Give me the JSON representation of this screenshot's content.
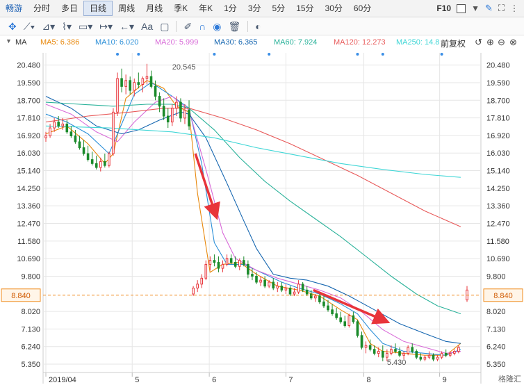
{
  "tabs": {
    "items": [
      "畅游",
      "分时",
      "多日",
      "日线",
      "周线",
      "月线",
      "季K",
      "年K",
      "1分",
      "3分",
      "5分",
      "15分",
      "30分",
      "60分"
    ],
    "active_index": 3,
    "f10": "F10",
    "small_down": "▼",
    "more": "⋮"
  },
  "toolbar": {
    "text_tool": "Aa"
  },
  "ma_bar": {
    "label": "MA",
    "items": [
      {
        "label": "MA5: 6.386",
        "color": "#e8880c"
      },
      {
        "label": "MA10: 6.020",
        "color": "#2b8fd8"
      },
      {
        "label": "MA20: 5.999",
        "color": "#d86ad8"
      },
      {
        "label": "MA30: 6.365",
        "color": "#1566b0"
      },
      {
        "label": "MA60: 7.924",
        "color": "#2ab29a"
      },
      {
        "label": "MA120: 12.273",
        "color": "#e85a5a"
      },
      {
        "label": "MA250: 14.8",
        "color": "#3fd6d6"
      }
    ],
    "adjust": "前复权"
  },
  "colors": {
    "up": "#e8343a",
    "down": "#1a8a2a",
    "current": "#f08c1e",
    "arrow": "#e8343a",
    "grid": "#e6e6e6",
    "axis_text": "#333333"
  },
  "chart_data": {
    "type": "line",
    "title": "",
    "y_ticks": [
      20.48,
      19.59,
      18.7,
      17.81,
      16.92,
      16.03,
      15.14,
      14.25,
      13.36,
      12.47,
      11.58,
      10.69,
      9.8,
      8.84,
      8.02,
      7.13,
      6.24,
      5.35
    ],
    "ylim": [
      5.0,
      21.1
    ],
    "x_labels": [
      {
        "label": "2019/04",
        "t": 0.0
      },
      {
        "label": "5",
        "t": 0.205
      },
      {
        "label": "6",
        "t": 0.388
      },
      {
        "label": "7",
        "t": 0.57
      },
      {
        "label": "8",
        "t": 0.755
      },
      {
        "label": "9",
        "t": 0.935
      }
    ],
    "current_price": 8.84,
    "current_label": "8.840",
    "annotations": [
      {
        "text": "20.545",
        "t": 0.3,
        "y": 20.4
      },
      {
        "text": "5.430",
        "t": 0.81,
        "y": 5.45
      }
    ],
    "candles_t": [
      0.0,
      0.01,
      0.02,
      0.03,
      0.04,
      0.05,
      0.06,
      0.07,
      0.08,
      0.09,
      0.1,
      0.11,
      0.12,
      0.13,
      0.14,
      0.15,
      0.16,
      0.17,
      0.18,
      0.19,
      0.2,
      0.21,
      0.22,
      0.23,
      0.24,
      0.25,
      0.26,
      0.27,
      0.28,
      0.29,
      0.3,
      0.31,
      0.32,
      0.33,
      0.34,
      0.35,
      0.36,
      0.37,
      0.38,
      0.39,
      0.4,
      0.41,
      0.42,
      0.43,
      0.44,
      0.45,
      0.46,
      0.47,
      0.48,
      0.49,
      0.5,
      0.51,
      0.52,
      0.53,
      0.54,
      0.55,
      0.56,
      0.57,
      0.58,
      0.59,
      0.6,
      0.61,
      0.62,
      0.63,
      0.64,
      0.65,
      0.66,
      0.67,
      0.68,
      0.69,
      0.7,
      0.71,
      0.72,
      0.73,
      0.74,
      0.75,
      0.76,
      0.77,
      0.78,
      0.79,
      0.8,
      0.81,
      0.82,
      0.83,
      0.84,
      0.85,
      0.86,
      0.87,
      0.88,
      0.89,
      0.9,
      0.91,
      0.92,
      0.93,
      0.94,
      0.95,
      0.96,
      0.97,
      0.98,
      1.0
    ],
    "candles_ohlc": [
      [
        16.8,
        17.1,
        16.6,
        16.9
      ],
      [
        16.9,
        17.5,
        16.8,
        17.3
      ],
      [
        17.3,
        17.8,
        17.1,
        17.6
      ],
      [
        17.6,
        17.9,
        17.3,
        17.4
      ],
      [
        17.4,
        17.8,
        17.2,
        17.5
      ],
      [
        17.5,
        17.7,
        17.0,
        17.1
      ],
      [
        17.1,
        17.4,
        16.8,
        16.9
      ],
      [
        16.9,
        17.2,
        16.5,
        16.6
      ],
      [
        16.6,
        16.9,
        16.2,
        16.3
      ],
      [
        16.3,
        16.7,
        15.9,
        16.0
      ],
      [
        16.0,
        16.4,
        15.6,
        15.7
      ],
      [
        15.7,
        16.1,
        15.4,
        15.5
      ],
      [
        15.5,
        15.9,
        15.2,
        15.3
      ],
      [
        15.3,
        15.8,
        15.1,
        15.6
      ],
      [
        15.6,
        16.0,
        15.3,
        15.4
      ],
      [
        15.4,
        16.1,
        15.3,
        16.0
      ],
      [
        16.0,
        18.3,
        15.9,
        18.1
      ],
      [
        18.1,
        20.1,
        17.9,
        19.8
      ],
      [
        19.8,
        20.3,
        19.1,
        19.4
      ],
      [
        19.4,
        20.0,
        19.0,
        19.7
      ],
      [
        19.7,
        19.9,
        19.0,
        19.2
      ],
      [
        19.2,
        19.8,
        18.9,
        19.6
      ],
      [
        19.6,
        20.1,
        19.3,
        19.5
      ],
      [
        19.5,
        19.9,
        19.1,
        19.8
      ],
      [
        19.8,
        20.545,
        19.5,
        19.9
      ],
      [
        19.9,
        20.2,
        19.3,
        19.4
      ],
      [
        19.4,
        19.7,
        18.7,
        18.9
      ],
      [
        18.9,
        19.1,
        18.1,
        18.4
      ],
      [
        18.4,
        18.8,
        17.7,
        17.9
      ],
      [
        17.9,
        18.3,
        17.3,
        17.6
      ],
      [
        17.6,
        18.5,
        17.4,
        18.3
      ],
      [
        18.3,
        18.9,
        17.9,
        18.6
      ],
      [
        18.6,
        18.8,
        17.6,
        17.8
      ],
      [
        17.8,
        18.5,
        17.5,
        18.2
      ],
      [
        18.2,
        18.7,
        17.2,
        17.4
      ],
      [
        8.9,
        9.3,
        8.8,
        9.2
      ],
      [
        9.2,
        9.6,
        9.0,
        9.4
      ],
      [
        9.4,
        9.9,
        9.2,
        9.7
      ],
      [
        9.7,
        10.6,
        9.6,
        10.4
      ],
      [
        10.4,
        10.8,
        10.1,
        10.6
      ],
      [
        10.6,
        10.9,
        10.3,
        10.5
      ],
      [
        10.5,
        10.8,
        10.0,
        10.2
      ],
      [
        10.2,
        10.6,
        10.0,
        10.4
      ],
      [
        10.4,
        10.9,
        10.3,
        10.7
      ],
      [
        10.7,
        10.9,
        10.4,
        10.5
      ],
      [
        10.5,
        10.8,
        10.2,
        10.3
      ],
      [
        10.3,
        10.7,
        10.1,
        10.6
      ],
      [
        10.6,
        10.8,
        10.3,
        10.4
      ],
      [
        10.4,
        10.6,
        9.7,
        9.9
      ],
      [
        9.9,
        10.2,
        9.6,
        9.8
      ],
      [
        9.8,
        10.0,
        9.4,
        9.5
      ],
      [
        9.5,
        9.8,
        9.3,
        9.6
      ],
      [
        9.6,
        9.8,
        9.2,
        9.3
      ],
      [
        9.3,
        9.6,
        9.2,
        9.5
      ],
      [
        9.5,
        9.7,
        9.1,
        9.2
      ],
      [
        9.2,
        9.5,
        9.0,
        9.3
      ],
      [
        9.3,
        9.5,
        9.0,
        9.1
      ],
      [
        9.1,
        9.4,
        8.9,
        9.2
      ],
      [
        9.2,
        9.3,
        8.8,
        8.9
      ],
      [
        8.9,
        9.2,
        8.8,
        9.0
      ],
      [
        9.0,
        9.6,
        8.9,
        9.4
      ],
      [
        9.4,
        9.5,
        9.0,
        9.1
      ],
      [
        9.1,
        9.3,
        8.8,
        8.9
      ],
      [
        8.9,
        9.1,
        8.6,
        8.7
      ],
      [
        8.7,
        8.9,
        8.5,
        8.8
      ],
      [
        8.8,
        9.0,
        8.4,
        8.5
      ],
      [
        8.5,
        8.8,
        8.2,
        8.3
      ],
      [
        8.3,
        8.6,
        8.0,
        8.1
      ],
      [
        8.1,
        8.4,
        7.8,
        7.9
      ],
      [
        7.9,
        8.2,
        7.6,
        7.7
      ],
      [
        7.7,
        8.0,
        7.4,
        7.5
      ],
      [
        7.5,
        7.8,
        7.2,
        7.3
      ],
      [
        7.3,
        7.9,
        7.2,
        7.8
      ],
      [
        7.8,
        8.0,
        7.4,
        7.5
      ],
      [
        7.5,
        7.6,
        6.7,
        6.8
      ],
      [
        6.8,
        7.0,
        6.1,
        6.2
      ],
      [
        6.2,
        6.5,
        5.9,
        6.3
      ],
      [
        6.3,
        6.6,
        6.0,
        6.1
      ],
      [
        6.1,
        6.3,
        5.8,
        5.9
      ],
      [
        5.9,
        6.2,
        5.7,
        6.0
      ],
      [
        6.0,
        6.3,
        5.5,
        5.7
      ],
      [
        5.7,
        6.1,
        5.5,
        5.9
      ],
      [
        5.9,
        6.3,
        5.8,
        6.1
      ],
      [
        6.1,
        6.4,
        5.9,
        6.0
      ],
      [
        6.0,
        6.2,
        5.7,
        5.8
      ],
      [
        5.8,
        6.0,
        5.6,
        5.9
      ],
      [
        5.9,
        6.3,
        5.8,
        6.2
      ],
      [
        6.2,
        6.4,
        5.9,
        6.0
      ],
      [
        6.0,
        6.1,
        5.6,
        5.7
      ],
      [
        5.7,
        5.9,
        5.5,
        5.6
      ],
      [
        5.6,
        5.8,
        5.5,
        5.7
      ],
      [
        5.7,
        6.0,
        5.6,
        5.8
      ],
      [
        5.8,
        5.9,
        5.5,
        5.6
      ],
      [
        5.6,
        5.8,
        5.5,
        5.7
      ],
      [
        5.7,
        6.0,
        5.6,
        5.9
      ],
      [
        5.9,
        6.1,
        5.7,
        5.8
      ],
      [
        5.8,
        6.0,
        5.7,
        5.9
      ],
      [
        5.9,
        6.1,
        5.8,
        6.0
      ],
      [
        6.0,
        6.3,
        5.9,
        6.2
      ],
      [
        8.6,
        9.3,
        8.5,
        9.1
      ]
    ],
    "series": [
      {
        "label": "MA5",
        "color": "#e8880c",
        "points": [
          [
            0.0,
            17.0
          ],
          [
            0.05,
            17.4
          ],
          [
            0.1,
            16.5
          ],
          [
            0.14,
            15.5
          ],
          [
            0.16,
            16.0
          ],
          [
            0.19,
            18.8
          ],
          [
            0.24,
            19.7
          ],
          [
            0.28,
            19.3
          ],
          [
            0.31,
            18.4
          ],
          [
            0.34,
            18.1
          ],
          [
            0.36,
            14.0
          ],
          [
            0.39,
            10.0
          ],
          [
            0.42,
            10.4
          ],
          [
            0.46,
            10.5
          ],
          [
            0.5,
            9.9
          ],
          [
            0.55,
            9.3
          ],
          [
            0.6,
            9.1
          ],
          [
            0.65,
            8.8
          ],
          [
            0.7,
            8.1
          ],
          [
            0.74,
            7.6
          ],
          [
            0.77,
            6.4
          ],
          [
            0.8,
            6.0
          ],
          [
            0.85,
            5.9
          ],
          [
            0.9,
            5.8
          ],
          [
            0.95,
            5.8
          ],
          [
            0.985,
            6.4
          ]
        ]
      },
      {
        "label": "MA10",
        "color": "#2b8fd8",
        "points": [
          [
            0.0,
            18.0
          ],
          [
            0.05,
            17.6
          ],
          [
            0.1,
            17.0
          ],
          [
            0.15,
            16.0
          ],
          [
            0.18,
            17.5
          ],
          [
            0.21,
            19.0
          ],
          [
            0.25,
            19.6
          ],
          [
            0.3,
            18.9
          ],
          [
            0.34,
            18.3
          ],
          [
            0.37,
            15.5
          ],
          [
            0.4,
            11.5
          ],
          [
            0.43,
            10.4
          ],
          [
            0.47,
            10.4
          ],
          [
            0.51,
            10.0
          ],
          [
            0.56,
            9.5
          ],
          [
            0.6,
            9.2
          ],
          [
            0.65,
            8.9
          ],
          [
            0.7,
            8.4
          ],
          [
            0.74,
            7.9
          ],
          [
            0.77,
            7.1
          ],
          [
            0.8,
            6.4
          ],
          [
            0.85,
            6.0
          ],
          [
            0.9,
            5.9
          ],
          [
            0.95,
            5.8
          ],
          [
            0.985,
            6.1
          ]
        ]
      },
      {
        "label": "MA20",
        "color": "#d86ad8",
        "points": [
          [
            0.0,
            18.5
          ],
          [
            0.06,
            18.0
          ],
          [
            0.12,
            17.1
          ],
          [
            0.17,
            16.6
          ],
          [
            0.21,
            17.6
          ],
          [
            0.26,
            18.6
          ],
          [
            0.3,
            18.9
          ],
          [
            0.34,
            18.2
          ],
          [
            0.38,
            15.2
          ],
          [
            0.42,
            12.0
          ],
          [
            0.45,
            10.7
          ],
          [
            0.5,
            10.1
          ],
          [
            0.55,
            9.7
          ],
          [
            0.6,
            9.4
          ],
          [
            0.65,
            9.1
          ],
          [
            0.7,
            8.7
          ],
          [
            0.75,
            8.0
          ],
          [
            0.8,
            7.1
          ],
          [
            0.85,
            6.5
          ],
          [
            0.9,
            6.2
          ],
          [
            0.95,
            5.9
          ],
          [
            0.985,
            6.0
          ]
        ]
      },
      {
        "label": "MA30",
        "color": "#1566b0",
        "points": [
          [
            0.0,
            18.9
          ],
          [
            0.06,
            18.3
          ],
          [
            0.12,
            17.4
          ],
          [
            0.18,
            17.0
          ],
          [
            0.22,
            17.2
          ],
          [
            0.27,
            17.7
          ],
          [
            0.32,
            18.1
          ],
          [
            0.34,
            18.0
          ],
          [
            0.38,
            16.8
          ],
          [
            0.43,
            14.5
          ],
          [
            0.47,
            12.6
          ],
          [
            0.5,
            11.2
          ],
          [
            0.54,
            9.9
          ],
          [
            0.58,
            9.7
          ],
          [
            0.62,
            9.6
          ],
          [
            0.67,
            9.3
          ],
          [
            0.72,
            8.8
          ],
          [
            0.78,
            8.1
          ],
          [
            0.84,
            7.4
          ],
          [
            0.9,
            6.9
          ],
          [
            0.95,
            6.5
          ],
          [
            0.985,
            6.4
          ]
        ]
      },
      {
        "label": "MA60",
        "color": "#2ab29a",
        "points": [
          [
            0.0,
            18.6
          ],
          [
            0.08,
            18.5
          ],
          [
            0.16,
            18.4
          ],
          [
            0.24,
            18.5
          ],
          [
            0.3,
            18.5
          ],
          [
            0.34,
            18.3
          ],
          [
            0.4,
            17.2
          ],
          [
            0.46,
            15.8
          ],
          [
            0.52,
            14.6
          ],
          [
            0.58,
            13.6
          ],
          [
            0.64,
            12.7
          ],
          [
            0.7,
            11.8
          ],
          [
            0.76,
            10.8
          ],
          [
            0.82,
            9.8
          ],
          [
            0.88,
            8.9
          ],
          [
            0.93,
            8.3
          ],
          [
            0.985,
            7.9
          ]
        ]
      },
      {
        "label": "MA120",
        "color": "#e85a5a",
        "points": [
          [
            0.0,
            17.6
          ],
          [
            0.1,
            17.9
          ],
          [
            0.2,
            18.1
          ],
          [
            0.28,
            18.3
          ],
          [
            0.34,
            18.3
          ],
          [
            0.42,
            17.8
          ],
          [
            0.5,
            17.2
          ],
          [
            0.58,
            16.5
          ],
          [
            0.66,
            15.7
          ],
          [
            0.74,
            14.9
          ],
          [
            0.82,
            14.0
          ],
          [
            0.9,
            13.1
          ],
          [
            0.985,
            12.3
          ]
        ]
      },
      {
        "label": "MA250",
        "color": "#3fd6d6",
        "points": [
          [
            0.0,
            17.4
          ],
          [
            0.15,
            17.3
          ],
          [
            0.3,
            17.1
          ],
          [
            0.4,
            16.8
          ],
          [
            0.5,
            16.3
          ],
          [
            0.6,
            15.9
          ],
          [
            0.7,
            15.5
          ],
          [
            0.8,
            15.2
          ],
          [
            0.9,
            14.95
          ],
          [
            0.985,
            14.8
          ]
        ]
      }
    ],
    "arrows": [
      {
        "from": [
          0.355,
          16.0
        ],
        "to": [
          0.405,
          12.8
        ]
      },
      {
        "from": [
          0.635,
          9.1
        ],
        "to": [
          0.81,
          7.5
        ]
      }
    ],
    "marker_dots_t": [
      0.17,
      0.22,
      0.4,
      0.53,
      0.74,
      0.8,
      0.94
    ]
  }
}
